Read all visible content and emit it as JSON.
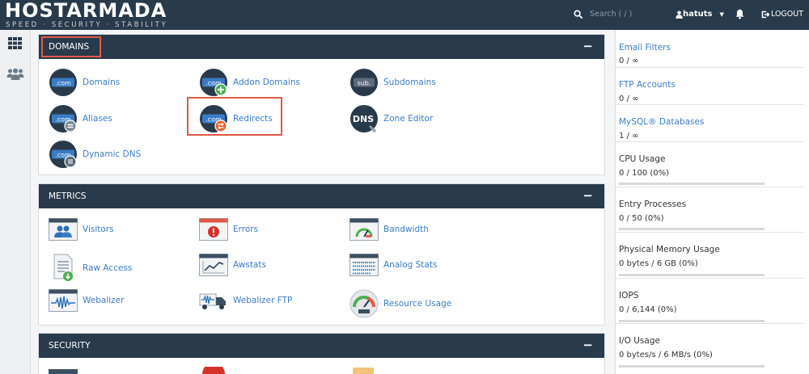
{
  "brand": {
    "name": "HOSTARMADA",
    "tagline": "SPEED · SECURITY · STABILITY"
  },
  "header": {
    "search_placeholder": "Search ( / )",
    "user": "hatuts",
    "logout": "LOGOUT"
  },
  "sections": {
    "domains": {
      "title": "DOMAINS",
      "items": [
        {
          "label": "Domains",
          "icon": "com-icon"
        },
        {
          "label": "Addon Domains",
          "icon": "com-plus-icon"
        },
        {
          "label": "Subdomains",
          "icon": "sub-icon"
        },
        {
          "label": "Aliases",
          "icon": "com-equals-icon"
        },
        {
          "label": "Redirects",
          "icon": "com-redirect-icon"
        },
        {
          "label": "Zone Editor",
          "icon": "dns-icon"
        },
        {
          "label": "Dynamic DNS",
          "icon": "com-network-icon"
        }
      ]
    },
    "metrics": {
      "title": "METRICS",
      "items": [
        {
          "label": "Visitors",
          "icon": "visitors-icon"
        },
        {
          "label": "Errors",
          "icon": "errors-icon"
        },
        {
          "label": "Bandwidth",
          "icon": "bandwidth-icon"
        },
        {
          "label": "Raw Access",
          "icon": "raw-access-icon"
        },
        {
          "label": "Awstats",
          "icon": "awstats-icon"
        },
        {
          "label": "Analog Stats",
          "icon": "analog-stats-icon"
        },
        {
          "label": "Webalizer",
          "icon": "webalizer-icon"
        },
        {
          "label": "Webalizer FTP",
          "icon": "webalizer-ftp-icon"
        },
        {
          "label": "Resource Usage",
          "icon": "resource-usage-icon"
        }
      ]
    },
    "security": {
      "title": "SECURITY"
    }
  },
  "stats": [
    {
      "label": "Email Filters",
      "value": "0 / ∞",
      "link": true
    },
    {
      "label": "FTP Accounts",
      "value": "0 / ∞",
      "link": true
    },
    {
      "label": "MySQL® Databases",
      "value": "1 / ∞",
      "link": true
    },
    {
      "label": "CPU Usage",
      "value": "0 / 100   (0%)",
      "percent": 0
    },
    {
      "label": "Entry Processes",
      "value": "0 / 50   (0%)",
      "percent": 0
    },
    {
      "label": "Physical Memory Usage",
      "value": "0 bytes / 6 GB   (0%)",
      "percent": 0
    },
    {
      "label": "IOPS",
      "value": "0 / 6,144   (0%)",
      "percent": 0
    },
    {
      "label": "I/O Usage",
      "value": "0 bytes/s / 6 MB/s   (0%)",
      "percent": 0
    }
  ],
  "colors": {
    "header": "#293a4a",
    "link": "#3a7cc4",
    "highlight": "#e05a47",
    "bar_track": "#d7d9db"
  }
}
